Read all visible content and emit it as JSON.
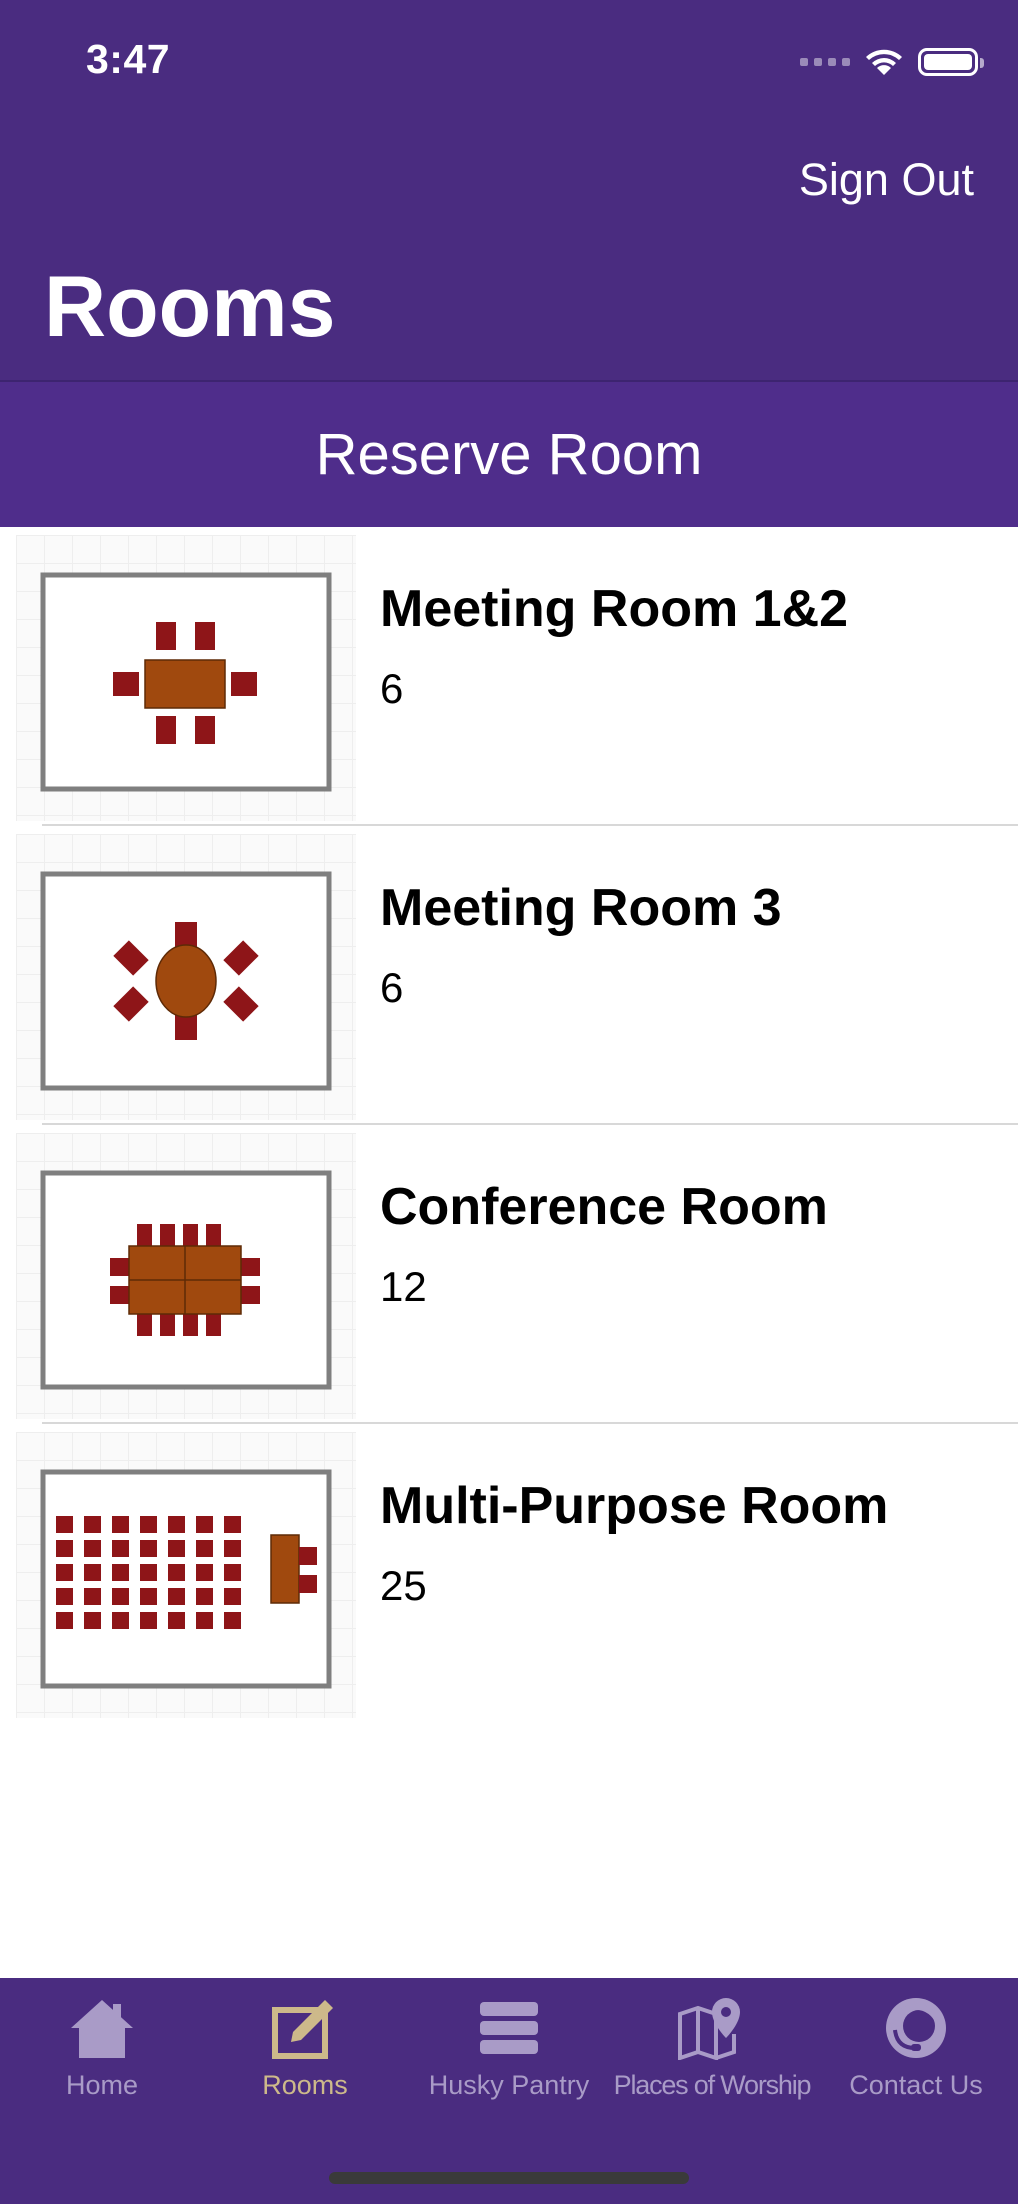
{
  "status_bar": {
    "time": "3:47"
  },
  "nav": {
    "sign_out_label": "Sign Out",
    "title": "Rooms"
  },
  "reserve_button": {
    "label": "Reserve Room"
  },
  "rooms": [
    {
      "name": "Meeting Room 1&2",
      "capacity": "6",
      "layout_icon": "rectangular-table-6-seats"
    },
    {
      "name": "Meeting Room 3",
      "capacity": "6",
      "layout_icon": "round-table-6-seats"
    },
    {
      "name": "Conference Room",
      "capacity": "12",
      "layout_icon": "conference-table-12-seats"
    },
    {
      "name": "Multi-Purpose Room",
      "capacity": "25",
      "layout_icon": "classroom-rows-layout"
    }
  ],
  "tabs": [
    {
      "label": "Home",
      "icon": "home-icon",
      "active": false
    },
    {
      "label": "Rooms",
      "icon": "edit-icon",
      "active": true
    },
    {
      "label": "Husky Pantry",
      "icon": "stack-icon",
      "active": false
    },
    {
      "label": "Places of Worship",
      "icon": "map-pin-icon",
      "active": false
    },
    {
      "label": "Contact Us",
      "icon": "headset-icon",
      "active": false
    }
  ],
  "colors": {
    "header_purple": "#4a2c80",
    "reserve_purple": "#4f2d8b",
    "active_tab": "#cdb98a",
    "inactive_tab": "#a99bc7",
    "table_brown": "#a0490e",
    "chair_red": "#8e1518"
  }
}
